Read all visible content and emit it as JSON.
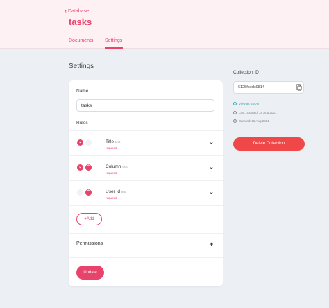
{
  "header": {
    "back_label": "Database",
    "title": "tasks",
    "tabs": [
      {
        "label": "Documents",
        "active": false
      },
      {
        "label": "Settings",
        "active": true
      }
    ]
  },
  "main": {
    "section_title": "Settings",
    "name_label": "Name",
    "name_value": "tasks",
    "rules_label": "Rules",
    "rules": [
      {
        "name": "Title",
        "type": "text",
        "required": "required"
      },
      {
        "name": "Column",
        "type": "text",
        "required": "required"
      },
      {
        "name": "User Id",
        "type": "text",
        "required": "required"
      }
    ],
    "add_label": "Add",
    "permissions_label": "Permissions",
    "update_label": "Update"
  },
  "sidebar": {
    "collection_id_label": "Collection ID",
    "collection_id_value": "6125fbedc9814",
    "view_json": "View as JSON",
    "last_updated": "Last Updated: 25 Aug 2021",
    "created": "Created: 25 Aug 2021",
    "delete_label": "Delete Collection"
  },
  "colors": {
    "accent": "#e8436a",
    "danger": "#f04848",
    "link": "#3aa6b0",
    "page_bg": "#eceff3",
    "header_bg": "#fdf1f3"
  }
}
